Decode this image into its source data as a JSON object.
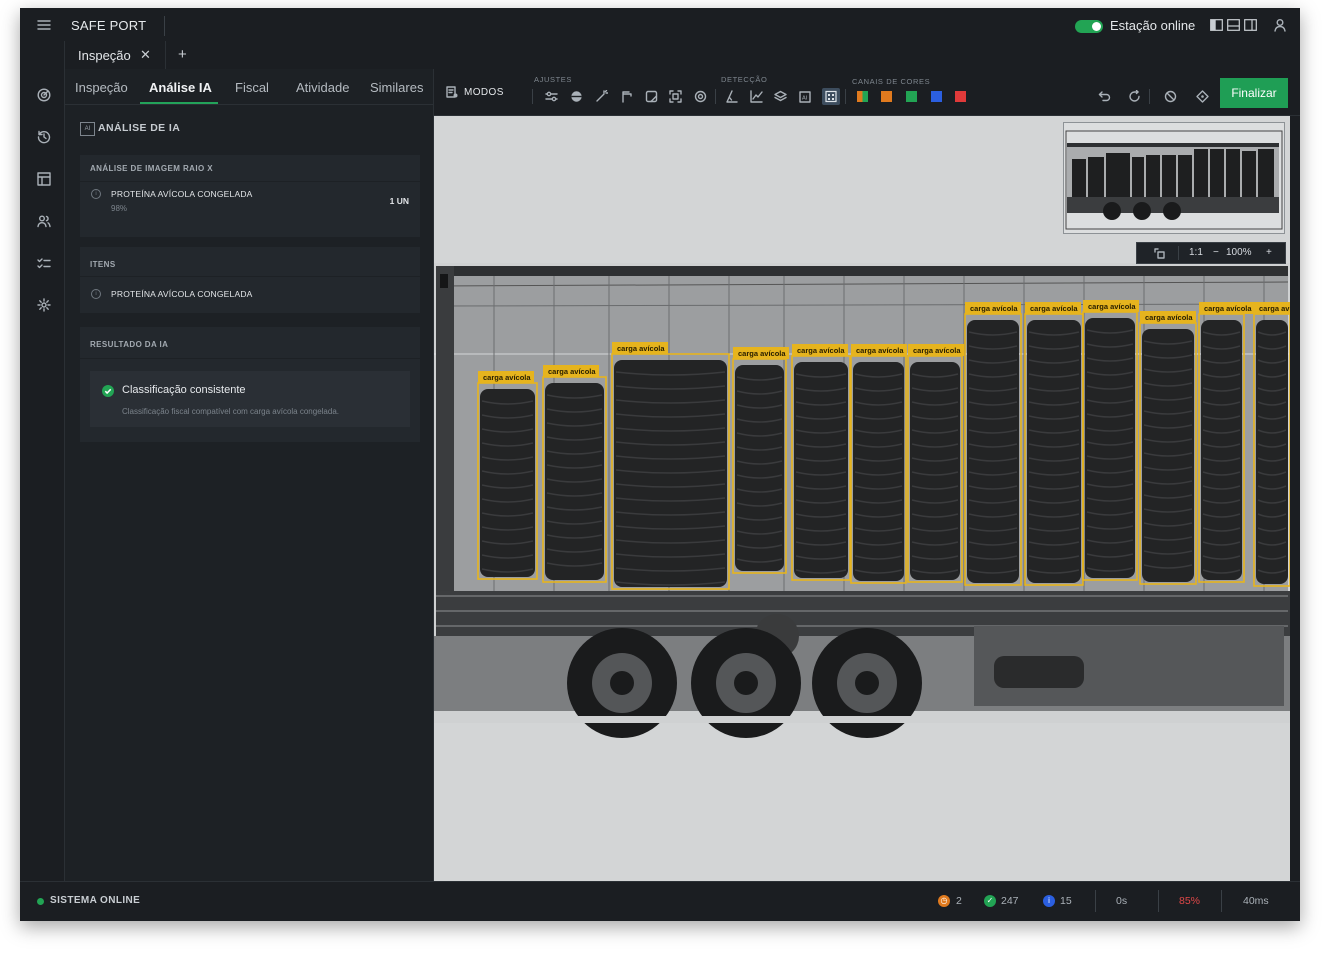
{
  "app": {
    "brand": "SAFE PORT",
    "station_status": "Estação online"
  },
  "doc_tabs": [
    {
      "label": "Inspeção",
      "close": "✕"
    }
  ],
  "add_tab": "+",
  "panel": {
    "tabs": [
      "Inspeção",
      "Análise IA",
      "Fiscal",
      "Atividade",
      "Similares"
    ],
    "active_tab": "Análise IA",
    "section_badge": "AI",
    "section_title": "ANÁLISE DE IA",
    "xray_card": {
      "header": "ANÁLISE DE IMAGEM RAIO X",
      "item": "PROTEÍNA AVÍCOLA CONGELADA",
      "confidence": "98%",
      "quantity": "1 UN"
    },
    "items_card": {
      "header": "ITENS",
      "item": "PROTEÍNA AVÍCOLA CONGELADA"
    },
    "result_card": {
      "header": "RESULTADO DA IA",
      "title": "Classificação consistente",
      "description": "Classificação fiscal compatível com carga avícola congelada."
    }
  },
  "toolbar": {
    "modes_label": "MODOS",
    "groups": [
      "AJUSTES",
      "DETECÇÃO",
      "CANAIS DE CORES"
    ],
    "color_channels": [
      "#e0701e",
      "#e07a1e",
      "#22a454",
      "#2b5fe0",
      "#e03a3a"
    ],
    "finalize_label": "Finalizar"
  },
  "viewer": {
    "zoom_fit": "1:1",
    "zoom_minus": "−",
    "zoom_level": "100%",
    "zoom_plus": "+",
    "detection_label": "carga avícola"
  },
  "status": {
    "system": "SISTEMA ONLINE",
    "pending_count": "2",
    "approved_count": "247",
    "info_count": "15",
    "time": "0s",
    "cpu": "85%",
    "latency": "40ms",
    "colors": {
      "pending": "#e07a1e",
      "approved": "#22a454",
      "info": "#2b5fe0",
      "cpu": "#e04848"
    }
  }
}
